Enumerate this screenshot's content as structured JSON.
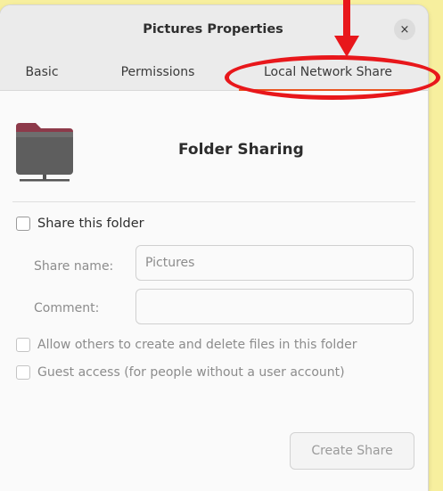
{
  "window": {
    "title": "Pictures Properties"
  },
  "tabs": [
    {
      "label": "Basic",
      "active": false
    },
    {
      "label": "Permissions",
      "active": false
    },
    {
      "label": "Local Network Share",
      "active": true
    }
  ],
  "icons": {
    "close": "close-icon",
    "folder": "folder-share-icon"
  },
  "close_glyph": "×",
  "folder": {
    "heading": "Folder Sharing"
  },
  "share": {
    "checkbox_label": "Share this folder",
    "checked": false,
    "name_label": "Share name:",
    "name_value": "Pictures",
    "comment_label": "Comment:",
    "comment_value": "",
    "allow_label": "Allow others to create and delete files in this folder",
    "guest_label": "Guest access (for people without a user account)"
  },
  "buttons": {
    "create_share": "Create Share"
  },
  "colors": {
    "background": "#f7ef9e",
    "accent": "#e95420",
    "annotation": "#e8171b",
    "folder_top": "#8d3a4a",
    "folder_body": "#5e5e5e"
  }
}
